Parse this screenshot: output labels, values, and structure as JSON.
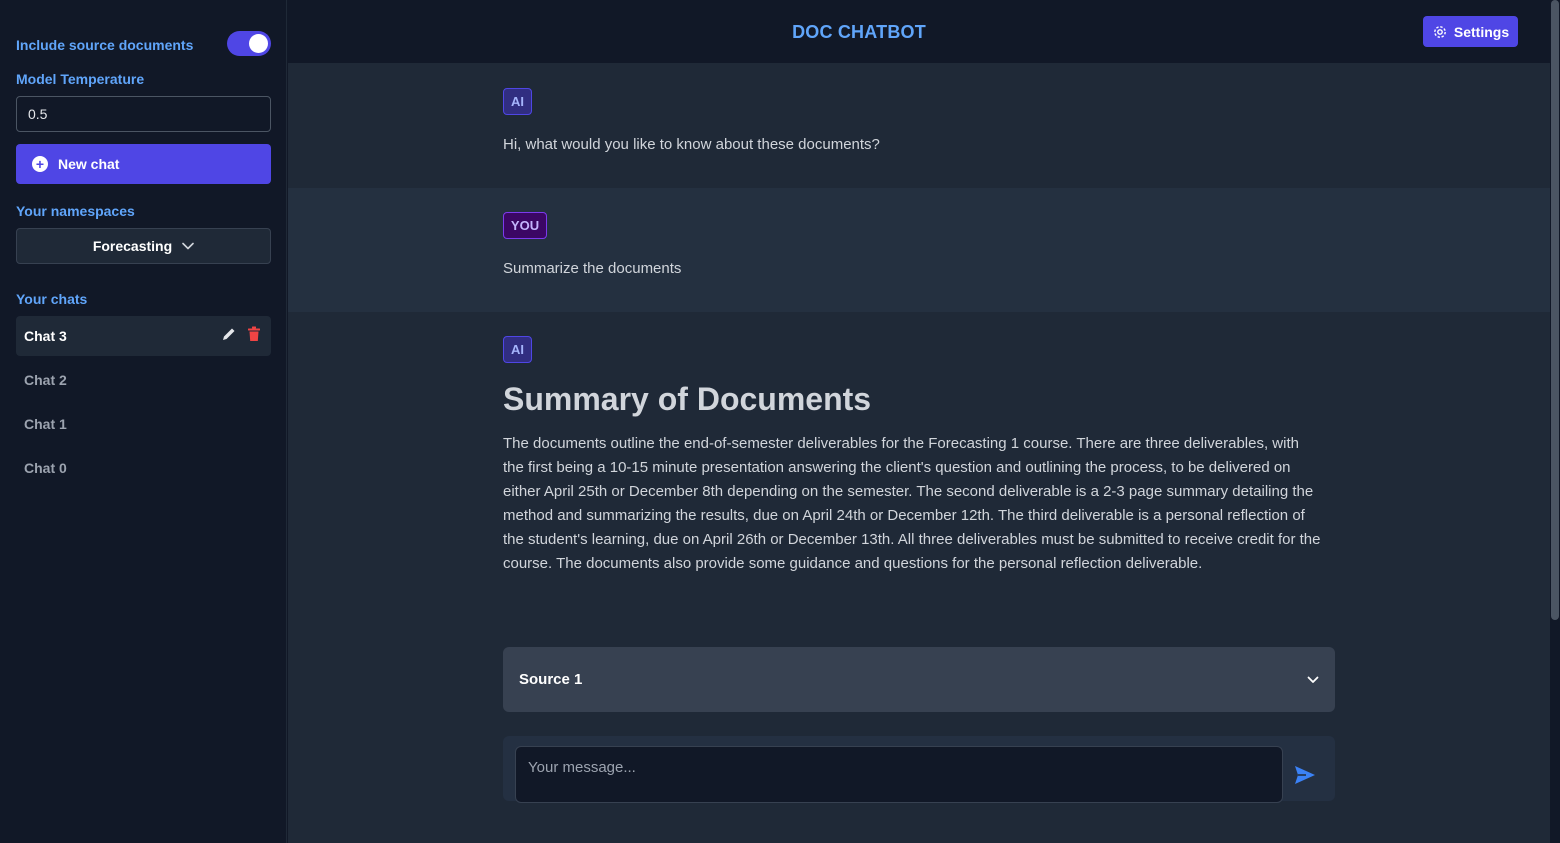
{
  "sidebar": {
    "include_sources_label": "Include source documents",
    "include_sources_on": true,
    "temperature_label": "Model Temperature",
    "temperature_value": "0.5",
    "new_chat_label": "New chat",
    "namespaces_label": "Your namespaces",
    "namespace_selected": "Forecasting",
    "chats_label": "Your chats",
    "chats": [
      {
        "label": "Chat 3",
        "active": true
      },
      {
        "label": "Chat 2",
        "active": false
      },
      {
        "label": "Chat 1",
        "active": false
      },
      {
        "label": "Chat 0",
        "active": false
      }
    ]
  },
  "header": {
    "title": "DOC CHATBOT",
    "settings_label": "Settings"
  },
  "messages": [
    {
      "role_badge": "AI",
      "text": "Hi, what would you like to know about these documents?"
    },
    {
      "role_badge": "YOU",
      "text": "Summarize the documents"
    },
    {
      "role_badge": "AI",
      "heading": "Summary of Documents",
      "text": "The documents outline the end-of-semester deliverables for the Forecasting 1 course. There are three deliverables, with the first being a 10-15 minute presentation answering the client's question and outlining the process, to be delivered on either April 25th or December 8th depending on the semester. The second deliverable is a 2-3 page summary detailing the method and summarizing the results, due on April 24th or December 12th. The third deliverable is a personal reflection of the student's learning, due on April 26th or December 13th. All three deliverables must be submitted to receive credit for the course. The documents also provide some guidance and questions for the personal reflection deliverable.",
      "source_label": "Source 1"
    }
  ],
  "composer": {
    "placeholder": "Your message..."
  },
  "colors": {
    "accent": "#4f46e5",
    "title": "#60a5fa",
    "sidebar_bg": "#111827",
    "main_bg": "#1f2937",
    "delete": "#ef4444"
  },
  "icons": {
    "new_chat": "plus-circle-icon",
    "settings": "gear-icon",
    "edit": "pencil-icon",
    "delete": "trash-icon",
    "dropdown": "chevron-down-icon",
    "send": "send-icon"
  }
}
